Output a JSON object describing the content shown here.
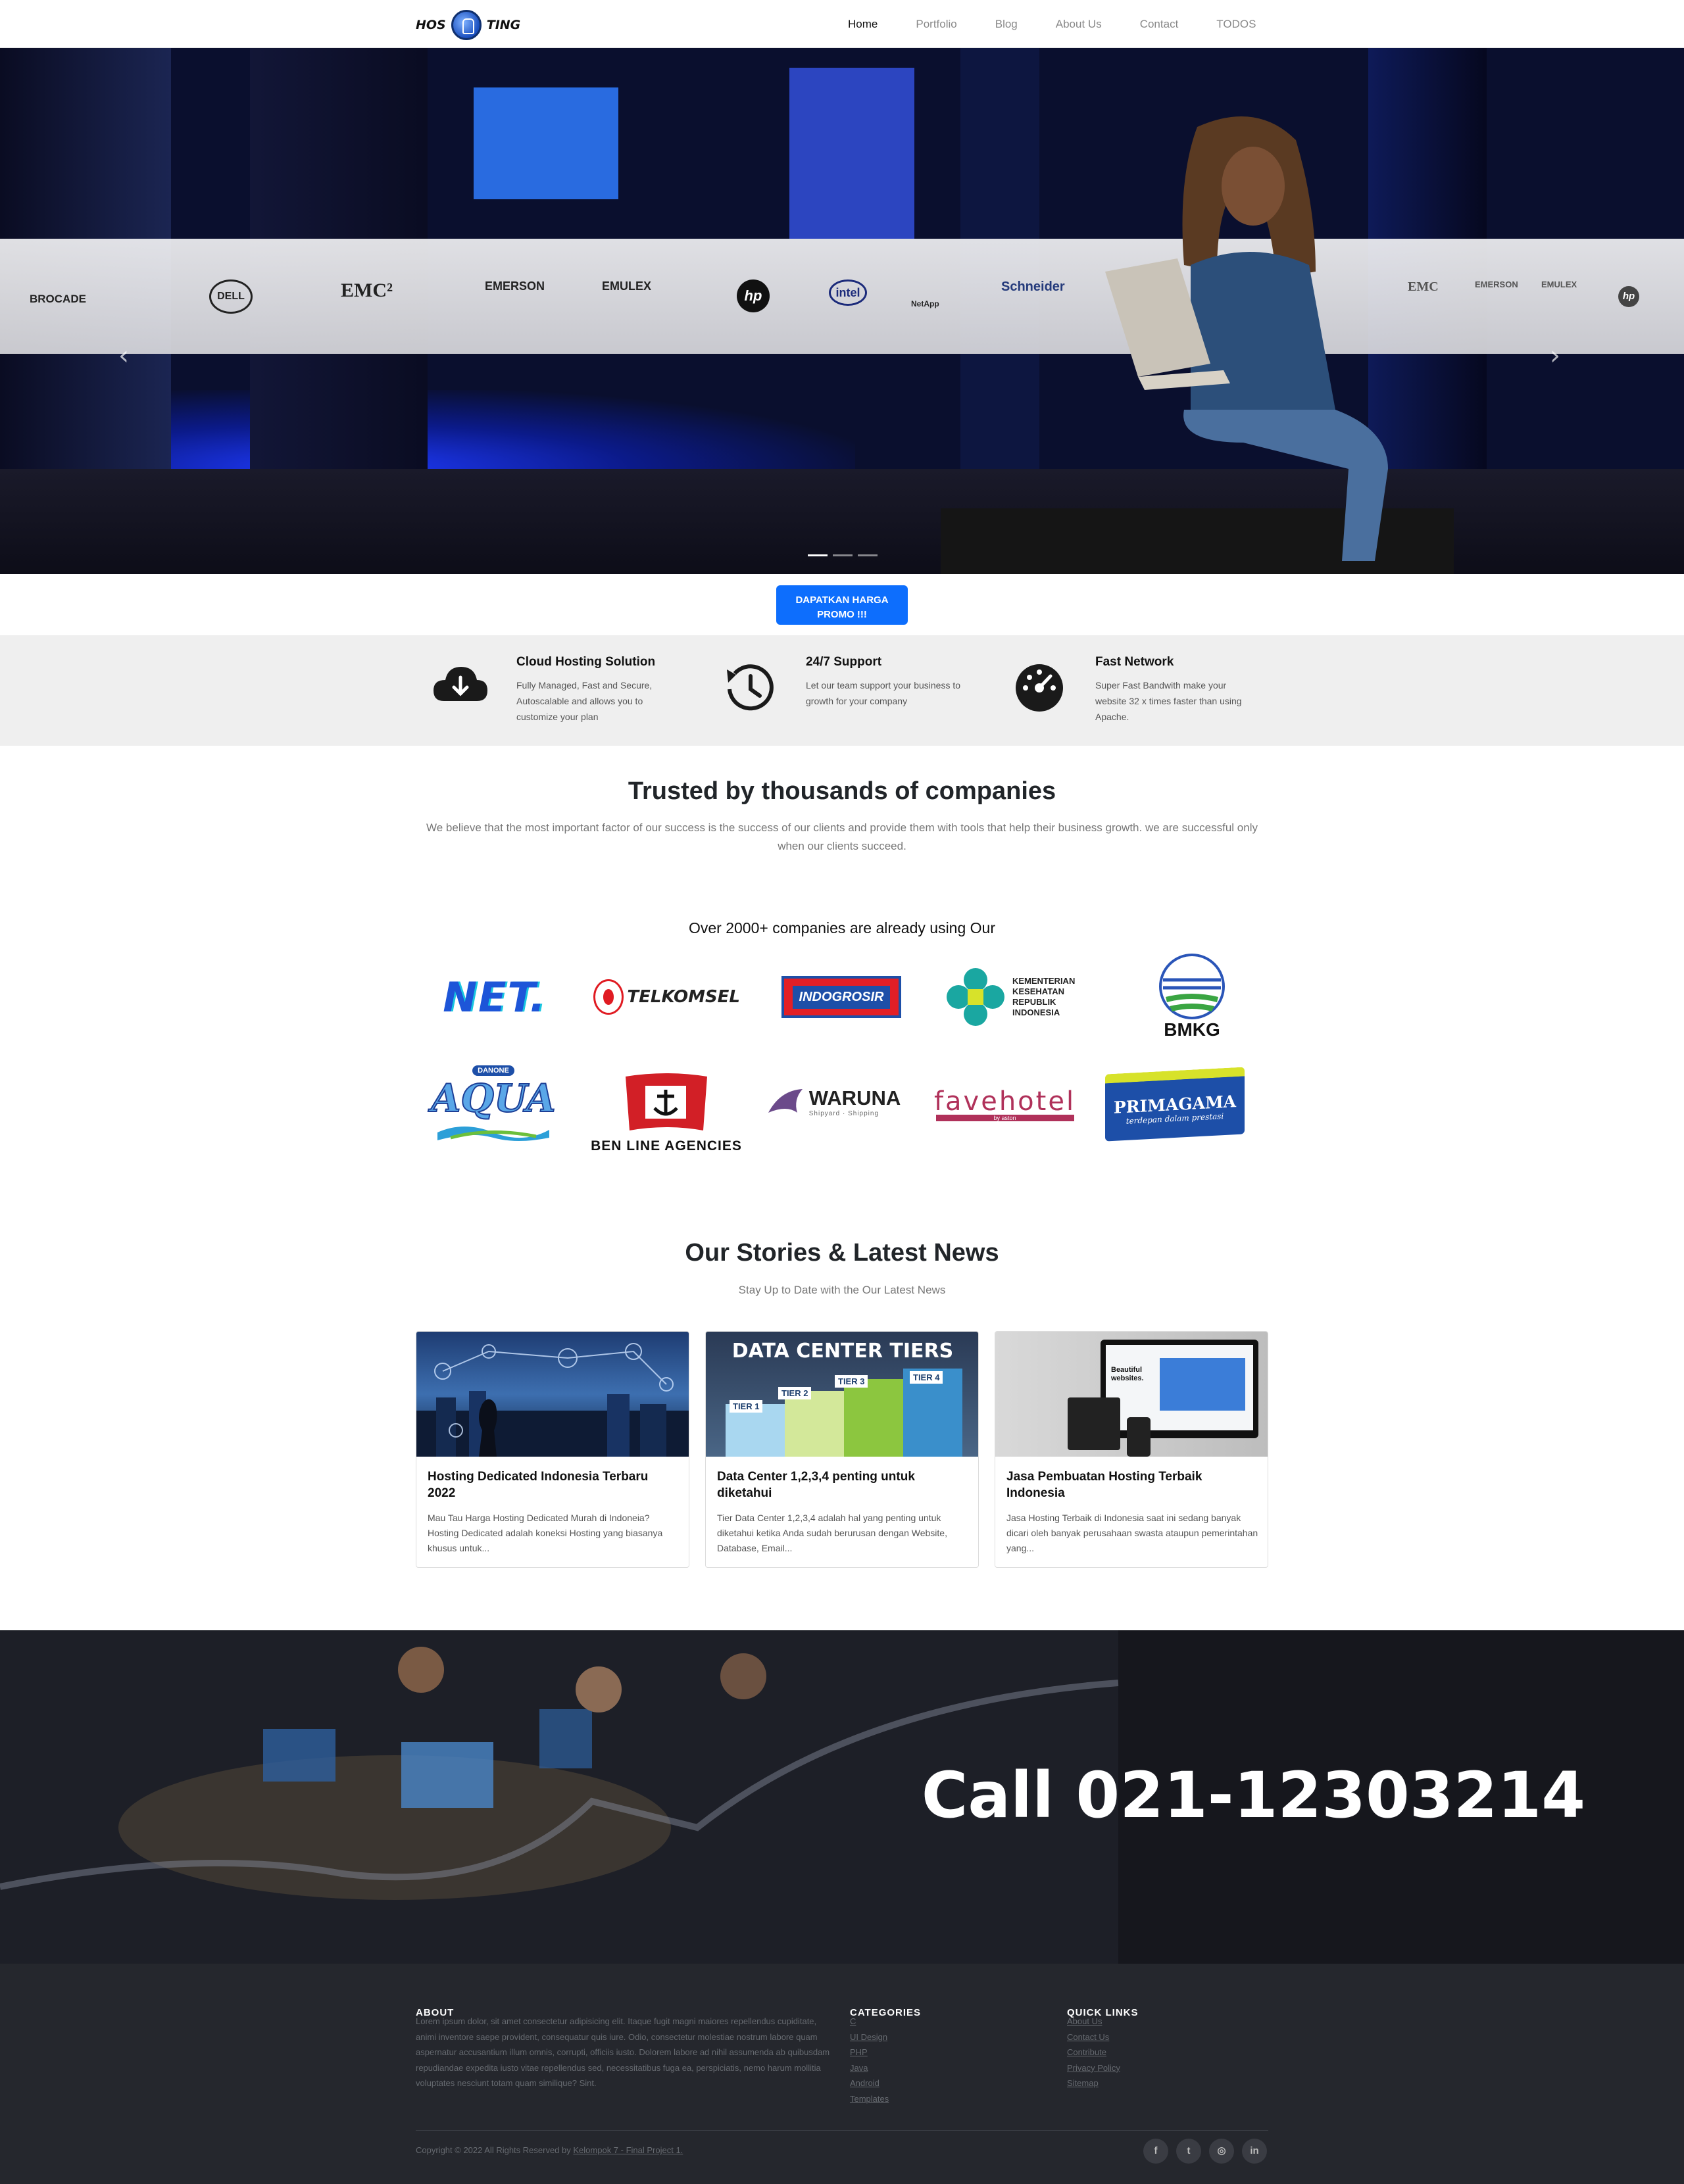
{
  "nav": {
    "logo_left": "HOS",
    "logo_right": "TING",
    "items": [
      {
        "label": "Home",
        "active": true
      },
      {
        "label": "Portfolio"
      },
      {
        "label": "Blog"
      },
      {
        "label": "About Us"
      },
      {
        "label": "Contact"
      },
      {
        "label": "TODOS"
      }
    ]
  },
  "hero": {
    "band_logos": [
      "BROCADE",
      "DELL",
      "EMC²",
      "EMERSON",
      "EMULEX",
      "hp",
      "intel",
      "NetApp",
      "Schneider",
      "EMC",
      "EMERSON",
      "EMULEX",
      "hp"
    ],
    "prev": "‹",
    "next": "›",
    "slides": 3,
    "active_slide": 1
  },
  "promo_button": "DAPATKAN HARGA PROMO !!!",
  "features": [
    {
      "icon": "cloud-download-icon",
      "title": "Cloud Hosting Solution",
      "text": "Fully Managed, Fast and Secure, Autoscalable and allows you to customize your plan"
    },
    {
      "icon": "history-icon",
      "title": "24/7 Support",
      "text": "Let our team support your business to growth for your company"
    },
    {
      "icon": "speedometer-icon",
      "title": "Fast Network",
      "text": "Super Fast Bandwith make your website 32 x times faster than using Apache."
    }
  ],
  "trusted": {
    "title": "Trusted by thousands of companies",
    "text": "We believe that the most important factor of our success is the success of our clients and provide them with tools that help their business growth. we are successful only when our clients succeed.",
    "subtitle": "Over 2000+ companies are already using Our"
  },
  "companies": [
    {
      "name": "NET."
    },
    {
      "name": "TELKOMSEL"
    },
    {
      "name": "INDOGROSIR"
    },
    {
      "name": "KEMENTERIAN KESEHATAN REPUBLIK INDONESIA"
    },
    {
      "name": "BMKG"
    },
    {
      "name": "AQUA",
      "badge": "DANONE"
    },
    {
      "name": "BEN LINE AGENCIES"
    },
    {
      "name": "WARUNA",
      "tag": "Shipyard · Shipping"
    },
    {
      "name": "favehotel",
      "tag": "by aston"
    },
    {
      "name": "PRIMAGAMA",
      "tag": "terdepan dalam prestasi"
    }
  ],
  "news": {
    "title": "Our Stories & Latest News",
    "subtitle": "Stay Up to Date with the Our Latest News",
    "cards": [
      {
        "title": "Hosting Dedicated Indonesia Terbaru 2022",
        "text": "Mau Tau Harga Hosting Dedicated Murah di Indoneia? Hosting Dedicated adalah koneksi Hosting yang biasanya khusus untuk..."
      },
      {
        "title": "Data Center 1,2,3,4 penting untuk diketahui",
        "text": "Tier Data Center 1,2,3,4 adalah hal yang penting untuk diketahui ketika Anda sudah berurusan dengan Website, Database, Email...",
        "image_title": "DATA CENTER TIERS",
        "tiers": [
          "TIER 1",
          "TIER 2",
          "TIER 3",
          "TIER 4"
        ]
      },
      {
        "title": "Jasa Pembuatan Hosting Terbaik Indonesia",
        "text": "Jasa Hosting Terbaik di Indonesia saat ini sedang banyak dicari oleh banyak perusahaan swasta ataupun pemerintahan yang...",
        "image_caption": "Beautiful websites."
      }
    ]
  },
  "call": {
    "text": "Call 021-12303214"
  },
  "footer": {
    "about_title": "ABOUT",
    "about_text": "Lorem ipsum dolor, sit amet consectetur adipisicing elit. Itaque fugit magni maiores repellendus cupiditate, animi inventore saepe provident, consequatur quis iure. Odio, consectetur molestiae nostrum labore quam aspernatur accusantium illum omnis, corrupti, officiis iusto. Dolorem labore ad nihil assumenda ab quibusdam repudiandae expedita iusto vitae repellendus sed, necessitatibus fuga ea, perspiciatis, nemo harum mollitia voluptates nesciunt totam quam similique? Sint.",
    "categories_title": "CATEGORIES",
    "categories": [
      "C",
      "UI Design",
      "PHP",
      "Java",
      "Android",
      "Templates"
    ],
    "quick_title": "QUICK LINKS",
    "quick": [
      "About Us",
      "Contact Us",
      "Contribute",
      "Privacy Policy",
      "Sitemap"
    ],
    "copyright": "Copyright © 2022 All Rights Reserved by",
    "copyright_link": "Kelompok 7 - Final Project 1.",
    "social": [
      {
        "icon": "facebook-icon",
        "glyph": "f"
      },
      {
        "icon": "twitter-icon",
        "glyph": "t"
      },
      {
        "icon": "instagram-icon",
        "glyph": "◎"
      },
      {
        "icon": "linkedin-icon",
        "glyph": "in"
      }
    ]
  },
  "colors": {
    "accent": "#0d6efd",
    "footer_bg": "#25272d",
    "feature_bg": "#efefef"
  }
}
